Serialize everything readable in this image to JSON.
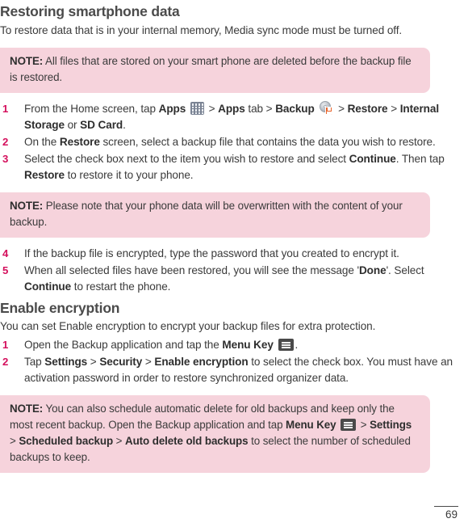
{
  "page": {
    "number": "69"
  },
  "sections": [
    {
      "heading": "Restoring smartphone data",
      "intro": "To restore data that is in your internal memory, Media sync mode must be turned off."
    },
    {
      "heading": "Enable encryption",
      "intro": "You can set Enable encryption to encrypt your backup files for extra protection."
    }
  ],
  "notes": {
    "note1": {
      "label": "NOTE:",
      "text": "All files that are stored on your smart phone are deleted before the backup file is restored."
    },
    "note2": {
      "label": "NOTE:",
      "text": "Please note that your phone data will be overwritten with the content of your backup."
    },
    "note3": {
      "label": "NOTE:",
      "part1": "You can also schedule automatic delete for old backups and keep only the most recent backup. Open the Backup application and tap ",
      "bold_menu_key": "Menu Key",
      "sep1": " > ",
      "bold_settings": "Settings",
      "sep2": " > ",
      "bold_scheduled_backup": "Scheduled backup",
      "sep3": " > ",
      "bold_auto_delete": "Auto delete old backups",
      "part2": " to select the number of scheduled backups to keep."
    }
  },
  "restore_steps": {
    "step1": {
      "num": "1",
      "t1": "From the Home screen, tap ",
      "b_apps1": "Apps",
      "t2": " > ",
      "b_apps2": "Apps",
      "t3": " tab > ",
      "b_backup": "Backup",
      "t4": " > ",
      "b_restore": "Restore",
      "t5": " > ",
      "b_internal": "Internal Storage",
      "t6": " or ",
      "b_sdcard": "SD Card",
      "t7": "."
    },
    "step2": {
      "num": "2",
      "t1": "On the ",
      "b1": "Restore",
      "t2": " screen, select a backup file that contains the data you wish to restore."
    },
    "step3": {
      "num": "3",
      "t1": "Select the check box next to the item you wish to restore and select ",
      "b1": "Continue",
      "t2": ". Then tap ",
      "b2": "Restore",
      "t3": " to restore it to your phone."
    },
    "step4": {
      "num": "4",
      "t1": "If the backup file is encrypted, type the password that you created to encrypt it."
    },
    "step5": {
      "num": "5",
      "t1": "When all selected files have been restored, you will see the message '",
      "b1": "Done",
      "t2": "'. Select ",
      "b2": "Continue",
      "t3": " to restart the phone."
    }
  },
  "encryption_steps": {
    "step1": {
      "num": "1",
      "t1": "Open the Backup application and tap the ",
      "b1": "Menu Key",
      "t2": "."
    },
    "step2": {
      "num": "2",
      "t1": "Tap ",
      "b1": "Settings",
      "t2": " > ",
      "b2": "Security",
      "t3": " > ",
      "b3": "Enable encryption",
      "t4": " to select the check box. You must have an activation password in order to restore synchronized organizer data."
    }
  },
  "icons": {
    "apps": "apps-grid-icon",
    "backup": "backup-disk-icon",
    "menu_key": "menu-key-icon"
  },
  "colors": {
    "note_background": "#f6d3dc",
    "step_number": "#d40f5c",
    "heading": "#4b4b4b",
    "body": "#3b3b3b"
  }
}
